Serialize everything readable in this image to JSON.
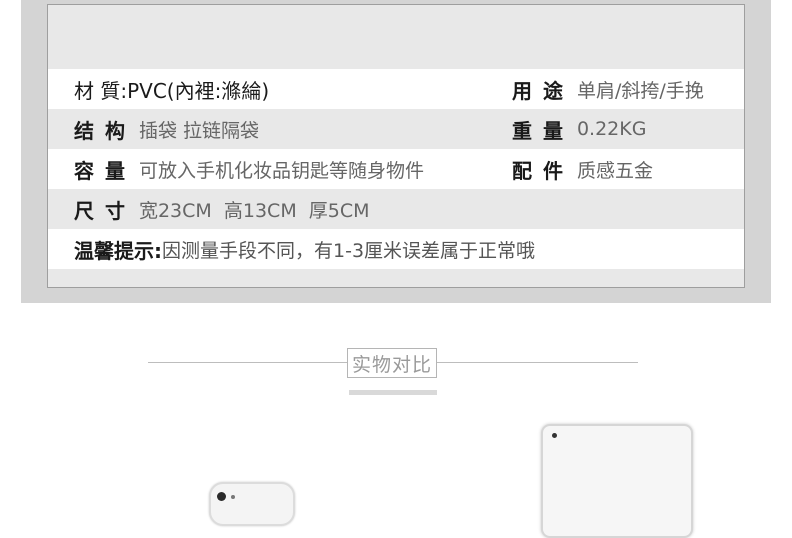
{
  "specs": {
    "row1": {
      "left": "材 質:PVC(內裡:滌綸)",
      "right_label": "用 途",
      "right_value": "单肩/斜挎/手挽"
    },
    "row2": {
      "left_label": "结 构",
      "left_value": "插袋 拉链隔袋",
      "right_label": "重 量",
      "right_value": "0.22KG"
    },
    "row3": {
      "left_label": "容 量",
      "left_value": "可放入手机化妆品钥匙等随身物件",
      "right_label": "配 件",
      "right_value": "质感五金"
    },
    "row4": {
      "left_label": "尺 寸",
      "left_value": "宽23CM  高13CM  厚5CM"
    },
    "row5": {
      "label": "温馨提示:",
      "value": "因测量手段不同，有1-3厘米误差属于正常哦"
    }
  },
  "comparison": {
    "title": "实物对比"
  },
  "colors": {
    "panel": "#d4d4d4",
    "card": "#e8e8e8",
    "label_text": "#1a1a1a",
    "value_text": "#666666"
  }
}
